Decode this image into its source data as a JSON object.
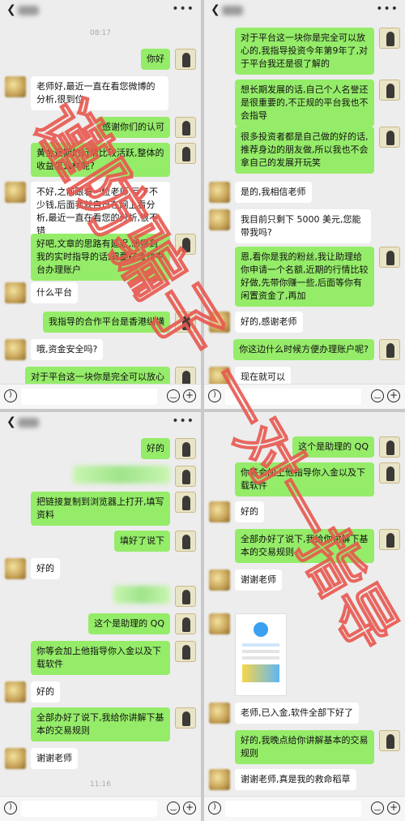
{
  "colors": {
    "bubble_out": "#95ec69",
    "bubble_in": "#ffffff",
    "background": "#ededed",
    "watermark": "#e8584f"
  },
  "panel1": {
    "time": "08:17",
    "messages": [
      "你好",
      "老师好,最近一直在看您微博的分析,很到位",
      "感谢你们的认可",
      "黄金近期的行情比较活跃,整体的收益怎么样呢?",
      "不好,之前跟着一位老师,亏了不少钱,后面我就自己在网上看分析,最近一直在看您的分析,很不错",
      "好吧,文章的思路有延迟,想得到我的实时指导的话,需要在合作平台办理账户",
      "什么平台",
      "我指导的合作平台是香港纵横",
      "哦,资金安全吗?",
      "对于平台这一块你是完全可以放心"
    ]
  },
  "panel2": {
    "messages": [
      "对于平台这一块你是完全可以放心的,我指导投资今年第9年了,对于平台我还是很了解的",
      "想长期发展的话,自己个人名誉还是很重要的,不正规的平台我也不会指导",
      "很多投资者都是自己做的好的话,推荐身边的朋友做,所以我也不会拿自己的发展开玩笑",
      "是的,我相信老师",
      "我目前只剩下 5000 美元,您能带我吗?",
      "恩,看你是我的粉丝,我让助理给你申请一个名额,近期的行情比较好做,先带你赚一些,后面等你有闲置资金了,再加",
      "好的,感谢老师",
      "你这边什么时候方便办理账户呢?",
      "现在就可以"
    ]
  },
  "panel3": {
    "time": "11:16",
    "messages": [
      "好的",
      "把链接复制到浏览器上打开,填写资料",
      "填好了说下",
      "好的",
      "这个是助理的 QQ",
      "你等会加上他指导你入金以及下载软件",
      "好的",
      "全部办好了说下,我给你讲解下基本的交易规则",
      "谢谢老师"
    ]
  },
  "panel4": {
    "messages": [
      "这个是助理的 QQ",
      "你等会加上他指导你入金以及下载软件",
      "好的",
      "全部办好了说下,我给你讲解下基本的交易规则",
      "谢谢老师",
      "老师,已入金,软件全部下好了",
      "好的,我晚点给你讲解基本的交易规则",
      "谢谢老师,真是我的救命稻草"
    ]
  },
  "watermark": {
    "lines": [
      "谨防骗子",
      "一对一指导"
    ]
  },
  "icons": {
    "back": "chevron-left-icon",
    "more": "more-dots-icon",
    "voice": "voice-icon",
    "emoji": "emoji-icon",
    "plus": "plus-icon"
  }
}
